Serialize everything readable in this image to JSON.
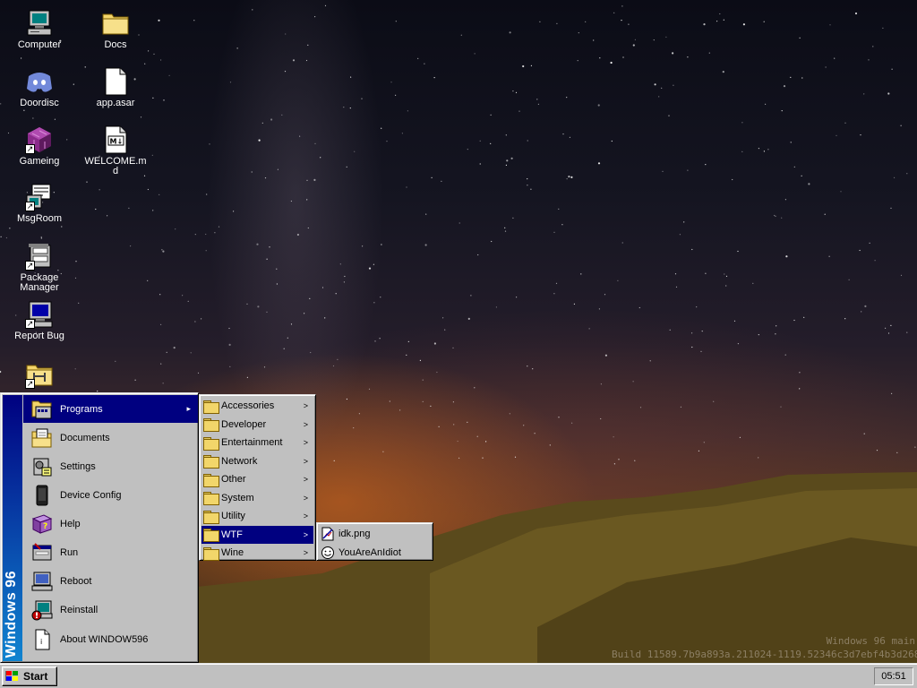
{
  "desktop": {
    "icons": [
      {
        "label": "Computer",
        "icon": "computer-icon"
      },
      {
        "label": "Docs",
        "icon": "folder-icon"
      },
      {
        "label": "Doordisc",
        "icon": "discord-icon"
      },
      {
        "label": "app.asar",
        "icon": "file-icon"
      },
      {
        "label": "Gameing",
        "icon": "game-cube-icon"
      },
      {
        "label": "WELCOME.md",
        "icon": "markdown-file-icon"
      },
      {
        "label": "MsgRoom",
        "icon": "chat-icon"
      },
      {
        "label": "Package Manager",
        "icon": "package-icon"
      },
      {
        "label": "Report Bug",
        "icon": "bug-report-icon"
      },
      {
        "label": "",
        "icon": "folder-network-icon"
      }
    ],
    "watermark": {
      "line1": "Windows 96 main",
      "line2": "Build 11589.7b9a893a.211024-1119.52346c3d7ebf4b3d2683"
    }
  },
  "start_menu": {
    "banner": "Windows 96",
    "items": [
      {
        "label": "Programs",
        "icon": "programs-icon",
        "has_submenu": true,
        "active": true
      },
      {
        "label": "Documents",
        "icon": "documents-icon"
      },
      {
        "label": "Settings",
        "icon": "settings-icon"
      },
      {
        "label": "Device Config",
        "icon": "device-icon"
      },
      {
        "label": "Help",
        "icon": "help-book-icon"
      },
      {
        "label": "Run",
        "icon": "run-icon"
      },
      {
        "label": "Reboot",
        "icon": "reboot-icon"
      },
      {
        "label": "Reinstall",
        "icon": "reinstall-icon"
      },
      {
        "label": "About WINDOW596",
        "icon": "about-icon"
      }
    ]
  },
  "programs_menu": {
    "items": [
      {
        "label": "Accessories"
      },
      {
        "label": "Developer"
      },
      {
        "label": "Entertainment"
      },
      {
        "label": "Network"
      },
      {
        "label": "Other"
      },
      {
        "label": "System"
      },
      {
        "label": "Utility"
      },
      {
        "label": "WTF",
        "active": true
      },
      {
        "label": "Wine"
      }
    ],
    "arrow": ">"
  },
  "wtf_menu": {
    "items": [
      {
        "label": "idk.png",
        "icon": "image-file-icon"
      },
      {
        "label": "YouAreAnIdiot",
        "icon": "smiley-icon"
      }
    ]
  },
  "taskbar": {
    "start_label": "Start",
    "clock": "05:51"
  },
  "colors": {
    "menu_highlight": "#000080",
    "face": "#c0c0c0"
  }
}
